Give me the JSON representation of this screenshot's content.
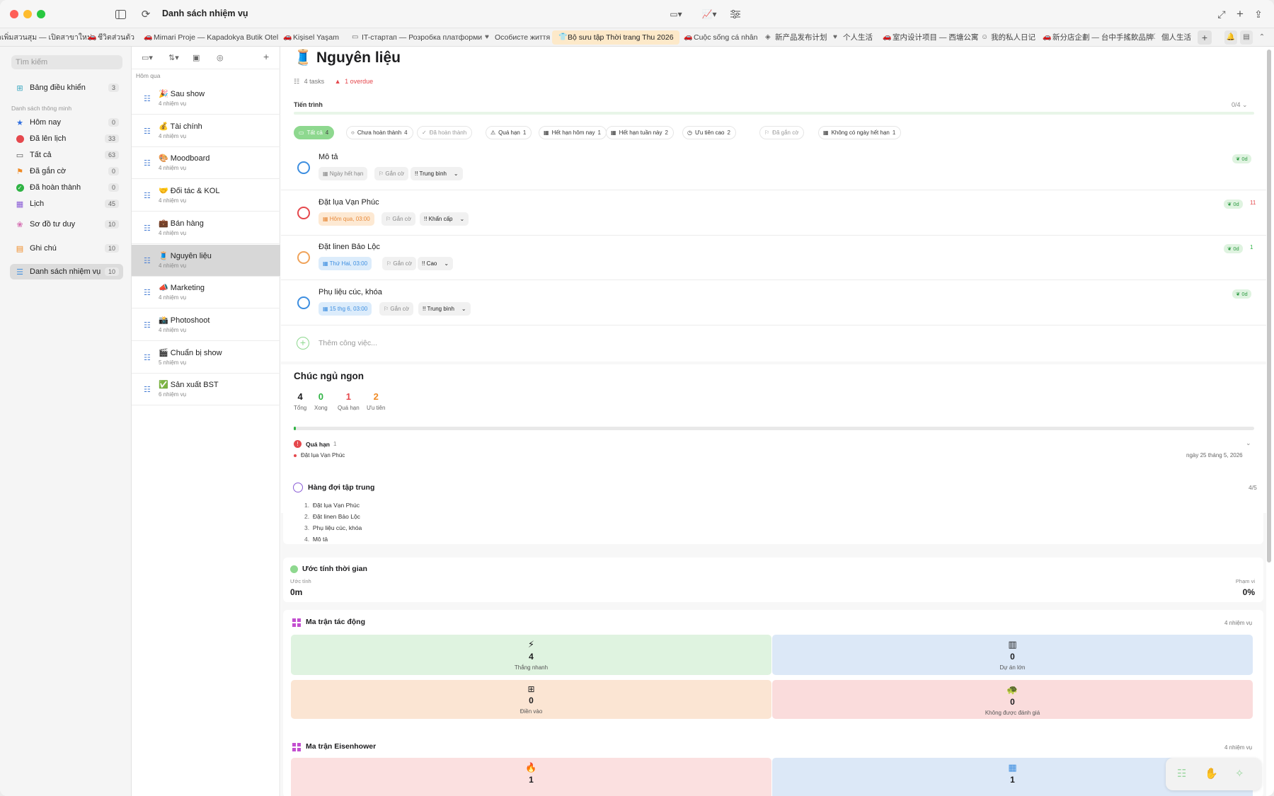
{
  "window": {
    "title": "Danh sách nhiệm vụ"
  },
  "tabs": [
    {
      "label": "าเพิ่มสวนสุม — เปิดสาขาใหม่",
      "icon": "store-icon"
    },
    {
      "label": "ชีวิตส่วนตัว",
      "icon": "car-icon"
    },
    {
      "label": "Mimari Proje — Kapadokya Butik Otel",
      "icon": "car-icon"
    },
    {
      "label": "Kişisel Yaşam",
      "icon": "car-icon"
    },
    {
      "label": "IT-стартап — Розробка платформи",
      "icon": "monitor-icon"
    },
    {
      "label": "Особисте життя",
      "icon": "heart-icon"
    },
    {
      "label": "Bộ sưu tập Thời trang Thu 2026",
      "icon": "shirt-icon",
      "active": true
    },
    {
      "label": "Cuộc sống cá nhân",
      "icon": "car-icon"
    },
    {
      "label": "新产品发布计划",
      "icon": "box-icon"
    },
    {
      "label": "个人生活",
      "icon": "heart-icon"
    },
    {
      "label": "室内设计项目 — 西塘公寓",
      "icon": "car-icon"
    },
    {
      "label": "我的私人日记",
      "icon": "person-icon"
    },
    {
      "label": "新分店企劃 — 台中手搖飲品牌",
      "icon": "car-icon"
    },
    {
      "label": "個人生活",
      "icon": "moon-icon"
    }
  ],
  "sidebar": {
    "search_placeholder": "Tìm kiếm",
    "dashboard": {
      "label": "Bảng điều khiển",
      "count": "3"
    },
    "smart_lists_header": "Danh sách thông minh",
    "smart": [
      {
        "label": "Hôm nay",
        "count": "0",
        "icon": "star-icon",
        "color": "#2f6fe0"
      },
      {
        "label": "Đã lên lịch",
        "count": "33",
        "icon": "calendar-dot-icon",
        "color": "#e5484d"
      },
      {
        "label": "Tất cả",
        "count": "63",
        "icon": "tray-icon",
        "color": "#555555"
      },
      {
        "label": "Đã gắn cờ",
        "count": "0",
        "icon": "flag-icon",
        "color": "#f08a24"
      },
      {
        "label": "Đã hoàn thành",
        "count": "0",
        "icon": "check-circle-icon",
        "color": "#2fb344"
      },
      {
        "label": "Lịch",
        "count": "45",
        "icon": "calendar-icon",
        "color": "#8a5cd6"
      }
    ],
    "mindmap": {
      "label": "Sơ đồ tư duy",
      "count": "10"
    },
    "notes": {
      "label": "Ghi chú",
      "count": "10"
    },
    "tasklists": {
      "label": "Danh sách nhiệm vụ",
      "count": "10"
    }
  },
  "list": {
    "group": "Hôm qua",
    "items": [
      {
        "title": "🎉 Sau show",
        "sub": "4 nhiệm vụ"
      },
      {
        "title": "💰 Tài chính",
        "sub": "4 nhiệm vụ"
      },
      {
        "title": "🎨 Moodboard",
        "sub": "4 nhiệm vụ"
      },
      {
        "title": "🤝 Đối tác & KOL",
        "sub": "4 nhiệm vụ"
      },
      {
        "title": "💼 Bán hàng",
        "sub": "4 nhiệm vụ"
      },
      {
        "title": "🧵 Nguyên liệu",
        "sub": "4 nhiệm vụ"
      },
      {
        "title": "📣 Marketing",
        "sub": "4 nhiệm vụ"
      },
      {
        "title": "📸 Photoshoot",
        "sub": "4 nhiệm vụ"
      },
      {
        "title": "🎬 Chuẩn bị show",
        "sub": "5 nhiệm vụ"
      },
      {
        "title": "✅ Sản xuất BST",
        "sub": "6 nhiệm vụ"
      }
    ]
  },
  "detail": {
    "title": "🧵 Nguyên liệu",
    "tasks_meta": "4 tasks",
    "overdue_meta": "1 overdue",
    "progress_label": "Tiến trình",
    "progress_value": "0/4",
    "progress_fraction": 0,
    "filters": [
      {
        "label": "Tất cả",
        "count": "4",
        "icon": "tray-icon"
      },
      {
        "label": "Chưa hoàn thành",
        "count": "4",
        "icon": "circle-icon"
      },
      {
        "label": "Đã hoàn thành",
        "count": "",
        "icon": "check-circle-icon"
      },
      {
        "label": "Quá hạn",
        "count": "1",
        "icon": "warning-icon"
      },
      {
        "label": "Hết hạn hôm nay",
        "count": "1",
        "icon": "calendar-icon"
      },
      {
        "label": "Hết hạn tuần này",
        "count": "2",
        "icon": "calendar-icon"
      },
      {
        "label": "Ưu tiên cao",
        "count": "2",
        "icon": "clock-icon"
      },
      {
        "label": "Đã gắn cờ",
        "count": "",
        "icon": "flag-icon"
      },
      {
        "label": "Không có ngày hết hạn",
        "count": "1",
        "icon": "calendar-x-icon"
      }
    ],
    "tasks": [
      {
        "title": "Mô tả",
        "date": "Ngày hết hạn",
        "date_style": "none",
        "flag": "Gắn cờ",
        "priority": "!! Trung bình",
        "circle": "#3d8ee0",
        "badge": "0d",
        "extra": ""
      },
      {
        "title": "Đặt lụa Vạn Phúc",
        "date": "Hôm qua, 03:00",
        "date_style": "overdue",
        "flag": "Gắn cờ",
        "priority": "!! Khẩn cấp",
        "circle": "#e5484d",
        "badge": "0d",
        "extra": "11"
      },
      {
        "title": "Đặt linen Bảo Lộc",
        "date": "Thứ Hai, 03:00",
        "date_style": "future",
        "flag": "Gắn cờ",
        "priority": "!! Cao",
        "circle": "#f0a35a",
        "badge": "0d",
        "extra": "1"
      },
      {
        "title": "Phụ liệu cúc, khóa",
        "date": "15 thg 6, 03:00",
        "date_style": "future",
        "flag": "Gắn cờ",
        "priority": "!! Trung bình",
        "circle": "#3d8ee0",
        "badge": "0d",
        "extra": ""
      }
    ],
    "add_task": "Thêm công việc..."
  },
  "summary": {
    "greeting": "Chúc ngủ ngon",
    "stats": [
      {
        "value": "4",
        "label": "Tổng",
        "color": "#1d1d1f"
      },
      {
        "value": "0",
        "label": "Xong",
        "color": "#2fb344"
      },
      {
        "value": "1",
        "label": "Quá hạn",
        "color": "#e5484d"
      },
      {
        "value": "2",
        "label": "Ưu tiên",
        "color": "#f08a24"
      }
    ],
    "overdue_label": "Quá hạn",
    "overdue_count": "1",
    "overdue_item": "Đặt lụa Vạn Phúc",
    "overdue_date": "ngày 25 tháng 5, 2026"
  },
  "focus": {
    "title": "Hàng đợi tập trung",
    "count": "4/5",
    "items": [
      "Đặt lụa Vạn Phúc",
      "Đặt linen Bảo Lộc",
      "Phụ liệu cúc, khóa",
      "Mô tả"
    ]
  },
  "estimate": {
    "title": "Ước tính thời gian",
    "left_label": "Ước tính",
    "left_value": "0m",
    "right_label": "Phạm vi",
    "right_value": "0%"
  },
  "impact": {
    "title": "Ma trận tác động",
    "count": "4 nhiệm vụ",
    "cells": [
      {
        "icon": "bolt-icon",
        "value": "4",
        "label": "Thắng nhanh",
        "bg": "#dff3e0"
      },
      {
        "icon": "building-icon",
        "value": "0",
        "label": "Dự án lớn",
        "bg": "#dce8f7"
      },
      {
        "icon": "grid-icon",
        "value": "0",
        "label": "Điền vào",
        "bg": "#fbe5d3"
      },
      {
        "icon": "turtle-icon",
        "value": "0",
        "label": "Không được đánh giá",
        "bg": "#fadcdc"
      }
    ]
  },
  "eisenhower": {
    "title": "Ma trận Eisenhower",
    "count": "4 nhiệm vụ",
    "cells": [
      {
        "icon": "fire-icon",
        "value": "1",
        "bg": "#fbe0e0"
      },
      {
        "icon": "calendar-icon",
        "value": "1",
        "bg": "#dce8f7"
      }
    ]
  }
}
